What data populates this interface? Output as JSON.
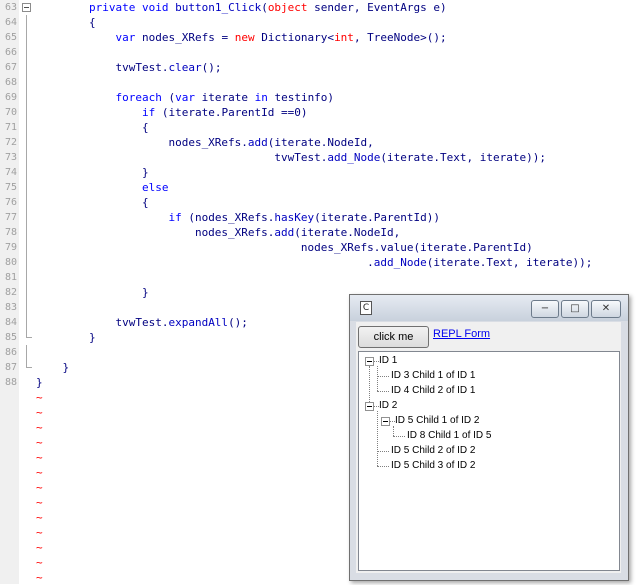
{
  "editor": {
    "lines": [
      {
        "num": "63",
        "html": "        <span class=\"kw\">private void</span> <span class=\"mt\">button1_Click</span>(<span class=\"ty\">object</span> sender, EventArgs e)"
      },
      {
        "num": "64",
        "html": "        {"
      },
      {
        "num": "65",
        "html": "            <span class=\"kw\">var</span> nodes_XRefs = <span class=\"ty\">new</span> Dictionary&lt;<span class=\"ty\">int</span>, TreeNode&gt;();"
      },
      {
        "num": "66",
        "html": ""
      },
      {
        "num": "67",
        "html": "            tvwTest.<span class=\"mt\">clear</span>();"
      },
      {
        "num": "68",
        "html": ""
      },
      {
        "num": "69",
        "html": "            <span class=\"kw\">foreach</span> (<span class=\"kw\">var</span> iterate <span class=\"kw\">in</span> testinfo)"
      },
      {
        "num": "70",
        "html": "                <span class=\"kw\">if</span> (iterate.ParentId ==0)"
      },
      {
        "num": "71",
        "html": "                {"
      },
      {
        "num": "72",
        "html": "                    nodes_XRefs.<span class=\"mt\">add</span>(iterate.NodeId,"
      },
      {
        "num": "73",
        "html": "                                    tvwTest.<span class=\"mt\">add_Node</span>(iterate.Text, iterate));"
      },
      {
        "num": "74",
        "html": "                }"
      },
      {
        "num": "75",
        "html": "                <span class=\"kw\">else</span>"
      },
      {
        "num": "76",
        "html": "                {"
      },
      {
        "num": "77",
        "html": "                    <span class=\"kw\">if</span> (nodes_XRefs.<span class=\"mt\">hasKey</span>(iterate.ParentId))"
      },
      {
        "num": "78",
        "html": "                        nodes_XRefs.<span class=\"mt\">add</span>(iterate.NodeId,"
      },
      {
        "num": "79",
        "html": "                                        nodes_XRefs.value(iterate.ParentId)"
      },
      {
        "num": "80",
        "html": "                                                  .<span class=\"mt\">add_Node</span>(iterate.Text, iterate));"
      },
      {
        "num": "81",
        "html": ""
      },
      {
        "num": "82",
        "html": "                }"
      },
      {
        "num": "83",
        "html": ""
      },
      {
        "num": "84",
        "html": "            tvwTest.<span class=\"mt\">expandAll</span>();"
      },
      {
        "num": "85",
        "html": "        }"
      },
      {
        "num": "86",
        "html": ""
      },
      {
        "num": "87",
        "html": "    }"
      },
      {
        "num": "88",
        "html": "}"
      }
    ],
    "tilde_char": "~",
    "tilde_count": 13
  },
  "window": {
    "app_icon": "C",
    "minimize_glyph": "−",
    "maximize_glyph": "□",
    "close_glyph": "✕",
    "button_label": "click me",
    "link_label": "REPL Form",
    "tree": [
      {
        "label": "ID 1",
        "level": 0,
        "expander": true
      },
      {
        "label": "ID 3 Child 1 of ID 1",
        "level": 1,
        "expander": false
      },
      {
        "label": "ID 4 Child 2 of ID 1",
        "level": 1,
        "expander": false
      },
      {
        "label": "ID 2",
        "level": 0,
        "expander": true
      },
      {
        "label": "ID 5 Child 1 of ID 2",
        "level": 1,
        "expander": true
      },
      {
        "label": "ID 8 Child 1 of ID 5",
        "level": 2,
        "expander": false
      },
      {
        "label": "ID 5 Child 2 of ID 2",
        "level": 1,
        "expander": false
      },
      {
        "label": "ID 5 Child 3 of ID 2",
        "level": 1,
        "expander": false
      }
    ]
  }
}
